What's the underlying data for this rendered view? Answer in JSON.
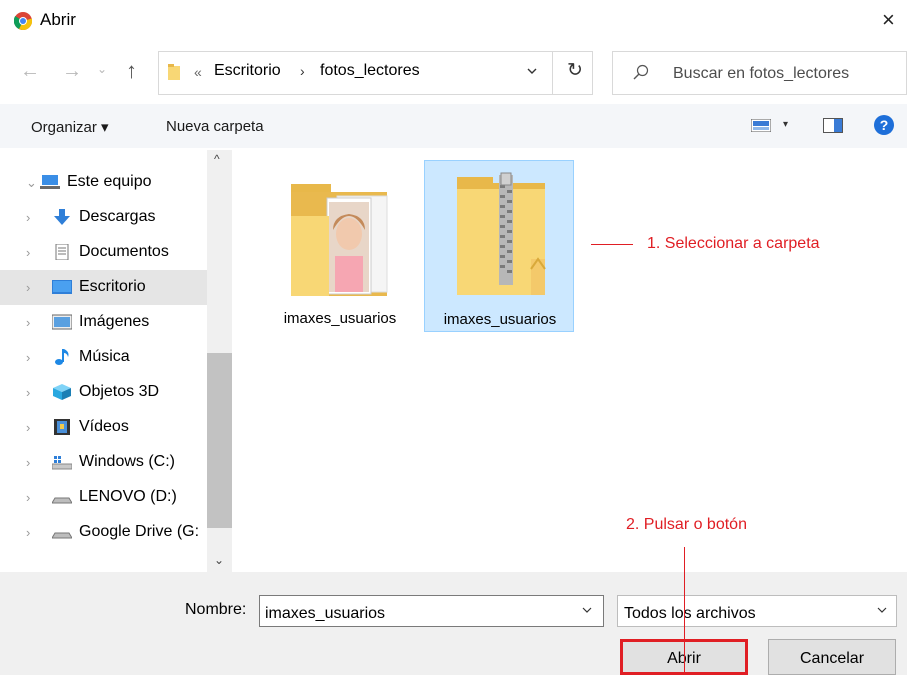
{
  "window": {
    "title": "Abrir",
    "close_glyph": "×",
    "icon": "chrome-icon"
  },
  "address": {
    "back_glyph": "←",
    "forward_glyph": "→",
    "recent_glyph": "⌄",
    "up_glyph": "↑",
    "prefix": "«",
    "crumbs": [
      "Escritorio",
      "fotos_lectores"
    ],
    "separator": "›",
    "refresh_glyph": "↻",
    "search_placeholder": "Buscar en fotos_lectores"
  },
  "toolbar": {
    "organize_label": "Organizar ▾",
    "new_folder_label": "Nueva carpeta",
    "view_dd": "▾",
    "help": "?"
  },
  "sidebar": {
    "items": [
      {
        "label": "Este equipo",
        "chev": "⌄",
        "icon": "computer-icon"
      },
      {
        "label": "Descargas",
        "chev": "›",
        "icon": "download-icon"
      },
      {
        "label": "Documentos",
        "chev": "›",
        "icon": "document-icon"
      },
      {
        "label": "Escritorio",
        "chev": "›",
        "icon": "desktop-icon",
        "selected": true
      },
      {
        "label": "Imágenes",
        "chev": "›",
        "icon": "pictures-icon"
      },
      {
        "label": "Música",
        "chev": "›",
        "icon": "music-icon"
      },
      {
        "label": "Objetos 3D",
        "chev": "›",
        "icon": "3d-objects-icon"
      },
      {
        "label": "Vídeos",
        "chev": "›",
        "icon": "videos-icon"
      },
      {
        "label": "Windows (C:)",
        "chev": "›",
        "icon": "windows-drive-icon"
      },
      {
        "label": "LENOVO (D:)",
        "chev": "›",
        "icon": "drive-icon"
      },
      {
        "label": "Google Drive (G:",
        "chev": "›",
        "icon": "drive-icon"
      }
    ],
    "scroll_up": "^",
    "scroll_down": "⌄"
  },
  "files": [
    {
      "name": "imaxes_usuarios",
      "type": "folder",
      "icon": "photo-folder-icon"
    },
    {
      "name": "imaxes_usuarios",
      "type": "zip",
      "icon": "zip-folder-icon",
      "selected": true
    }
  ],
  "annotations": {
    "step1": "1. Seleccionar a carpeta",
    "step2": "2. Pulsar o botón",
    "color": "#e01e24"
  },
  "bottom": {
    "name_label": "Nombre:",
    "name_value": "imaxes_usuarios",
    "filter_value": "Todos los archivos",
    "open_label": "Abrir",
    "cancel_label": "Cancelar"
  }
}
